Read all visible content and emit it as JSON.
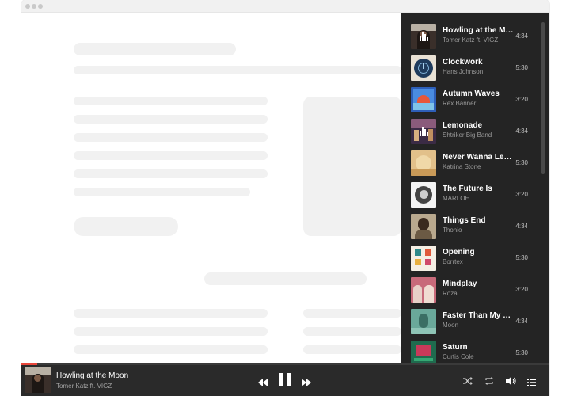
{
  "playlist": {
    "tracks": [
      {
        "title": "Howling at the Moon",
        "artist": "Tomer Katz ft. VIGZ",
        "duration": "4:34",
        "playing": true,
        "cover": "cover-moon"
      },
      {
        "title": "Clockwork",
        "artist": "Hans Johnson",
        "duration": "5:30",
        "cover": "cover-clock"
      },
      {
        "title": "Autumn Waves",
        "artist": "Rex Banner",
        "duration": "3:20",
        "cover": "cover-sunset"
      },
      {
        "title": "Lemonade",
        "artist": "Shtriker Big Band",
        "duration": "4:34",
        "playing": true,
        "cover": "cover-band"
      },
      {
        "title": "Never Wanna Let You Go",
        "artist": "Katrina Stone",
        "duration": "5:30",
        "cover": "cover-gold"
      },
      {
        "title": "The Future Is",
        "artist": "MARLOE.",
        "duration": "3:20",
        "cover": "cover-portrait-bw"
      },
      {
        "title": "Things End",
        "artist": "Thonio",
        "duration": "4:34",
        "cover": "cover-portrait"
      },
      {
        "title": "Opening",
        "artist": "Borrtex",
        "duration": "5:30",
        "cover": "cover-pattern"
      },
      {
        "title": "Mindplay",
        "artist": "Roza",
        "duration": "3:20",
        "cover": "cover-duo"
      },
      {
        "title": "Faster Than My Heart",
        "artist": "Moon",
        "duration": "4:34",
        "cover": "cover-teal"
      },
      {
        "title": "Saturn",
        "artist": "Curtis Cole",
        "duration": "5:30",
        "cover": "cover-saturn"
      }
    ]
  },
  "now_playing": {
    "title": "Howling at the Moon",
    "artist": "Tomer Katz ft. VIGZ",
    "progress": 0.03,
    "cover": "cover-moon"
  },
  "icons": {
    "rewind": "rewind-icon",
    "pause": "pause-icon",
    "forward": "fast-forward-icon",
    "shuffle": "shuffle-icon",
    "repeat": "repeat-icon",
    "volume": "volume-icon",
    "queue": "queue-list-icon"
  },
  "colors": {
    "accent": "#e8463a",
    "panel": "#242424",
    "player": "#2a2a2a"
  }
}
